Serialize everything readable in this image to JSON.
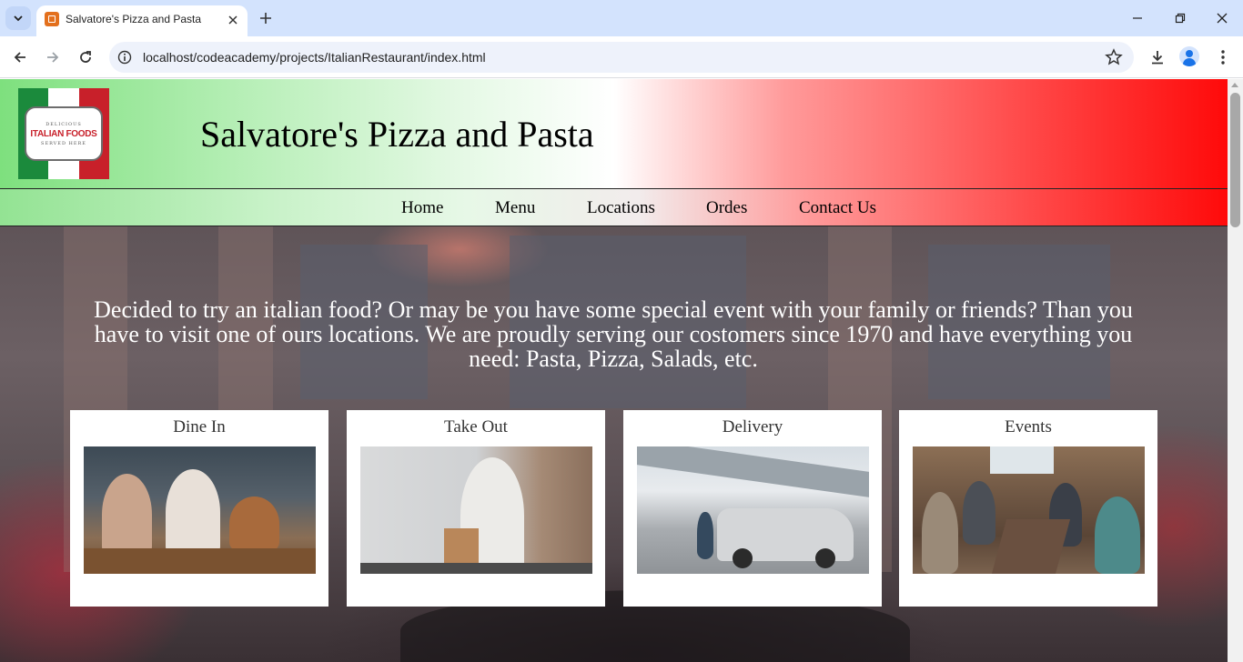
{
  "browser": {
    "tab_title": "Salvatore's Pizza and Pasta",
    "url": "localhost/codeacademy/projects/ItalianRestaurant/index.html"
  },
  "site": {
    "title": "Salvatore's Pizza and Pasta",
    "logo": {
      "top_text": "DELICIOUS",
      "main_text": "ITALIAN FOODS",
      "bottom_text": "SERVED HERE"
    },
    "nav": [
      "Home",
      "Menu",
      "Locations",
      "Ordes",
      "Contact Us"
    ],
    "intro": "Decided to try an italian food? Or may be you have some special event with your family or friends? Than you have to visit one of ours locations. We are proudly serving our costomers since 1970 and have everything you need: Pasta, Pizza, Salads, etc.",
    "cards": [
      {
        "title": "Dine In"
      },
      {
        "title": "Take Out"
      },
      {
        "title": "Delivery"
      },
      {
        "title": "Events"
      }
    ]
  },
  "colors": {
    "tabbar": "#d3e3fd",
    "header_green": "#7ee07e",
    "header_red": "#ff0a0a",
    "flag_green": "#1b8a3c",
    "flag_red": "#c8202a"
  }
}
